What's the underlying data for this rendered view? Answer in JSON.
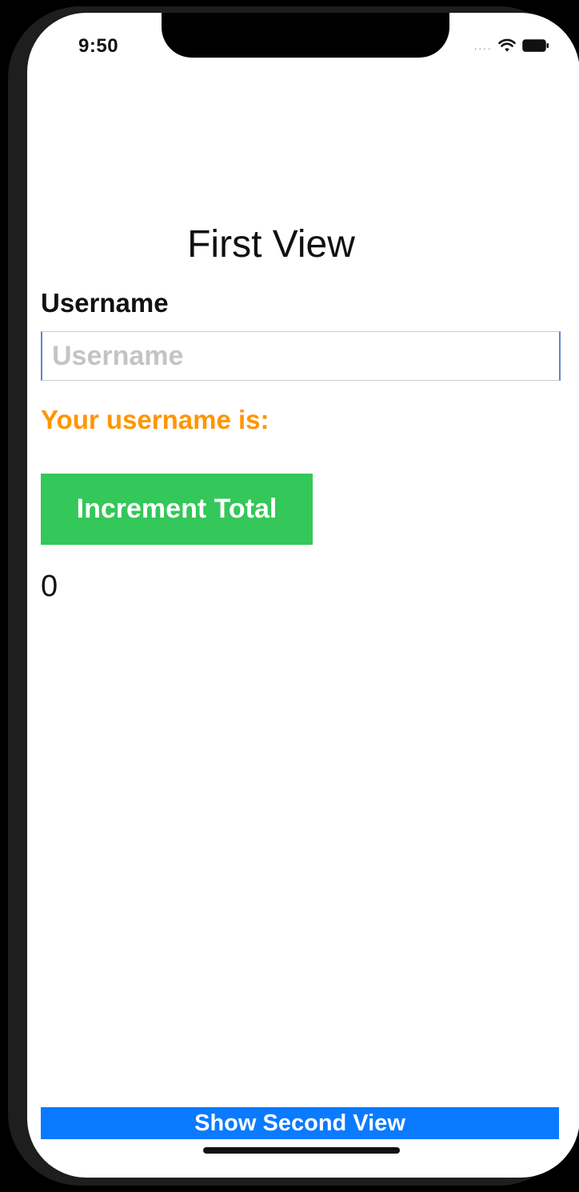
{
  "status_bar": {
    "time": "9:50",
    "signal_icon": "signal-dots-icon",
    "wifi_icon": "wifi-icon",
    "battery_icon": "battery-icon"
  },
  "main": {
    "title": "First View",
    "username_label": "Username",
    "username_input": {
      "placeholder": "Username",
      "value": ""
    },
    "username_display": "Your username is:",
    "increment_button_label": "Increment Total",
    "total": "0",
    "show_second_button_label": "Show Second View"
  },
  "colors": {
    "accent_orange": "#ff9500",
    "button_green": "#34c759",
    "button_blue": "#0a7aff"
  }
}
